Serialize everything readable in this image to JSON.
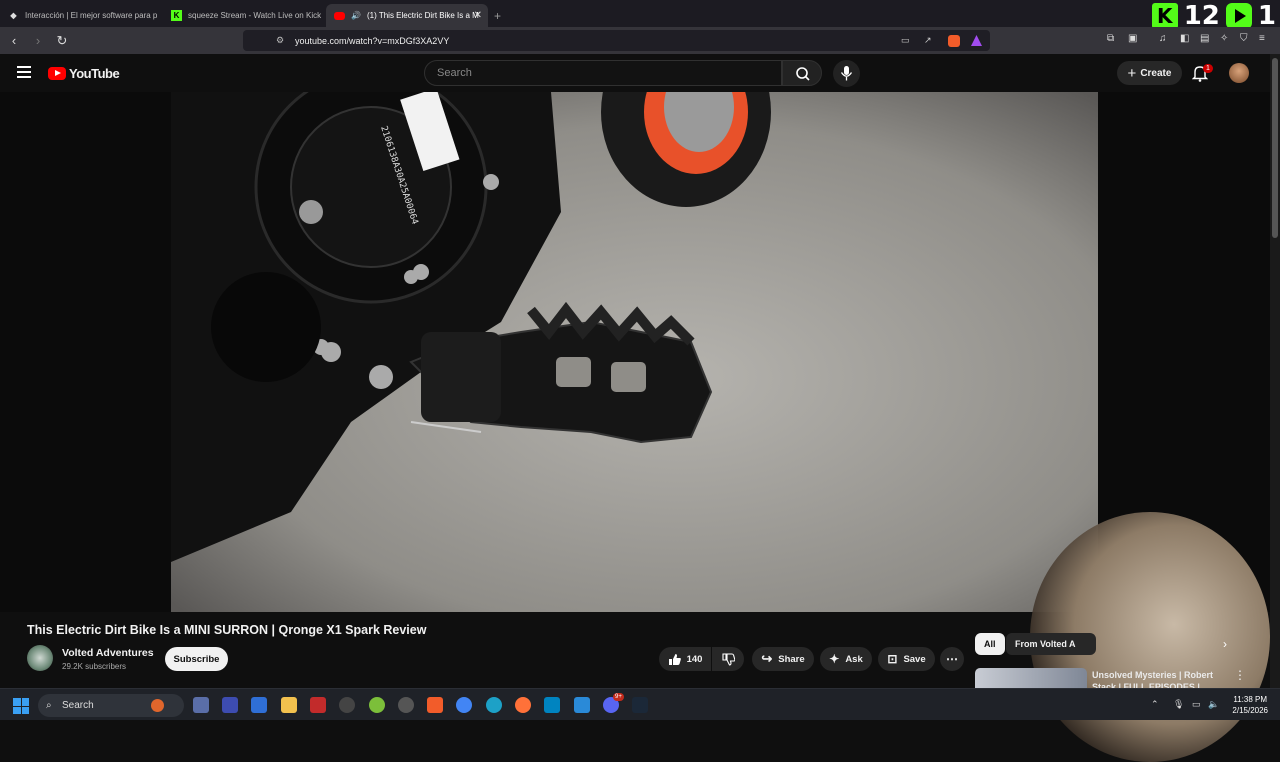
{
  "browser": {
    "tabs": [
      {
        "label": "Interacción | El mejor software para p",
        "active": false
      },
      {
        "label": "squeeze Stream - Watch Live on Kick",
        "active": false
      },
      {
        "label": "(1) This Electric Dirt Bike Is a M",
        "active": true
      }
    ],
    "url": "youtube.com/watch?v=mxDGf3XA2VY"
  },
  "kick_overlay": {
    "count1": "12",
    "count2": "1"
  },
  "youtube": {
    "logo": "YouTube",
    "search_placeholder": "Search",
    "create_label": "Create",
    "notification_count": "1",
    "video": {
      "title": "This Electric Dirt Bike Is a MINI SURRON | Qronge X1 Spark Review",
      "channel": "Volted Adventures",
      "subscribers": "29.2K subscribers",
      "subscribe_label": "Subscribe",
      "likes": "140",
      "share_label": "Share",
      "ask_label": "Ask",
      "save_label": "Save",
      "visible_serial": "2106138A30A25A00064"
    },
    "chips": [
      "All",
      "From Volted A"
    ],
    "recommended": [
      {
        "title": "Unsolved Mysteries | Robert Stack | FULL EPISODES |"
      }
    ]
  },
  "taskbar": {
    "search_placeholder": "Search",
    "time": "11:38 PM",
    "date": "2/15/2026",
    "discord_badge": "9+"
  },
  "colors": {
    "youtube_red": "#ff0000",
    "kick_green": "#53fc18",
    "windows_blue": "#3aa0f3"
  }
}
